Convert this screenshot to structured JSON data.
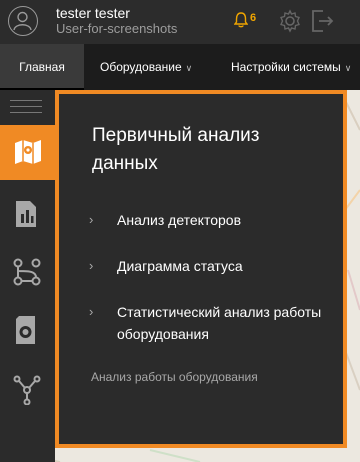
{
  "header": {
    "user_name": "tester tester",
    "user_role": "User-for-screenshots",
    "notification_count": "6",
    "accent_color": "#f0a500"
  },
  "nav": {
    "home": "Главная",
    "equipment": "Оборудование",
    "settings": "Настройки системы"
  },
  "sidebar": {
    "items": [
      {
        "icon": "map-icon",
        "active": true
      },
      {
        "icon": "report-icon",
        "active": false
      },
      {
        "icon": "process-icon",
        "active": false
      },
      {
        "icon": "device-icon",
        "active": false
      },
      {
        "icon": "network-icon",
        "active": false
      }
    ],
    "active_color": "#f08a24"
  },
  "panel": {
    "title": "Первичный анализ данных",
    "items": [
      "Анализ детекторов",
      "Диаграмма статуса",
      "Статистический анализ работы оборудования"
    ],
    "footer": "Анализ работы оборудования"
  }
}
